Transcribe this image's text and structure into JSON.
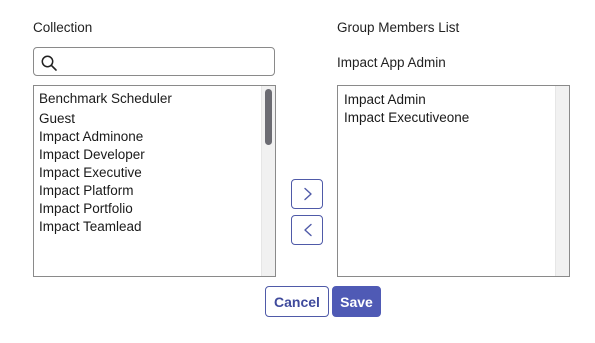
{
  "collection": {
    "label": "Collection",
    "search_placeholder": "",
    "search_value": "",
    "items": [
      "Benchmark Scheduler",
      "Guest",
      "Impact Adminone",
      "Impact Developer",
      "Impact Executive",
      "Impact Platform",
      "Impact Portfolio",
      "Impact Teamlead"
    ]
  },
  "members": {
    "label": "Group Members List",
    "group_name": "Impact App Admin",
    "items": [
      "Impact Admin",
      "Impact Executiveone"
    ]
  },
  "actions": {
    "cancel_label": "Cancel",
    "save_label": "Save"
  },
  "icons": {
    "search": "search-icon",
    "add": "chevron-right-icon",
    "remove": "chevron-left-icon"
  },
  "colors": {
    "accent": "#4f5ab5",
    "accent_border": "#4f5aa8",
    "scroll_thumb": "#6b6b72"
  }
}
